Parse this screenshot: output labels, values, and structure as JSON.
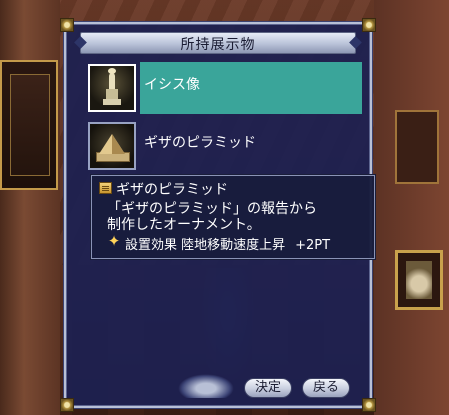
{
  "window": {
    "title": "所持展示物"
  },
  "items": [
    {
      "name": "イシス像",
      "icon": "statue-icon",
      "selected": true
    },
    {
      "name": "ギザのピラミッド",
      "icon": "pyramid-icon",
      "selected": false
    }
  ],
  "tooltip": {
    "name": "ギザのピラミッド",
    "description_line1": "「ギザのピラミッド」の報告から",
    "description_line2": "制作したオーナメント。",
    "effect_label": "設置効果 陸地移動速度上昇",
    "effect_bonus": "+2PT"
  },
  "buttons": {
    "ok_label": "決定",
    "back_label": "戻る"
  },
  "colors": {
    "selection": "#3aa59a",
    "panel": "#1c2152",
    "tooltip_bg": "#181c3c"
  }
}
